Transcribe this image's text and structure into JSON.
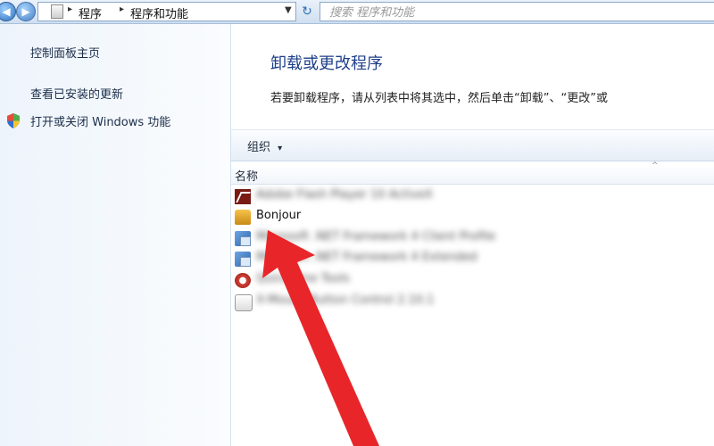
{
  "address_bar": {
    "breadcrumb": [
      "程序",
      "程序和功能"
    ],
    "search_placeholder": "搜索 程序和功能"
  },
  "sidebar": {
    "items": [
      {
        "label": "控制面板主页"
      },
      {
        "label": "查看已安装的更新"
      },
      {
        "label": "打开或关闭 Windows 功能",
        "icon": "shield-icon"
      }
    ]
  },
  "main": {
    "title": "卸载或更改程序",
    "description": "若要卸载程序，请从列表中将其选中，然后单击“卸载”、“更改”或",
    "toolbar": {
      "organize_label": "组织",
      "organize_arrow": "▾"
    },
    "column_header": {
      "name": "名称",
      "sort_glyph": "^"
    },
    "programs": [
      {
        "name": "Adobe Flash Player 10 ActiveX",
        "icon": "flash-icon",
        "blurred": true
      },
      {
        "name": "Bonjour",
        "icon": "bonjour-icon",
        "blurred": false
      },
      {
        "name": "Microsoft .NET Framework 4 Client Profile",
        "icon": "net-framework-icon",
        "blurred": true
      },
      {
        "name": "Microsoft .NET Framework 4 Extended",
        "icon": "net-framework-icon",
        "blurred": true
      },
      {
        "name": "QuickTime Tools",
        "icon": "quicktime-icon",
        "blurred": true
      },
      {
        "name": "X-Mouse Button Control 2.10.1",
        "icon": "app-icon",
        "blurred": true
      }
    ]
  },
  "colors": {
    "title": "#1f3f8a",
    "arrow": "#e8262a",
    "address_bar": "#cfdff0"
  }
}
